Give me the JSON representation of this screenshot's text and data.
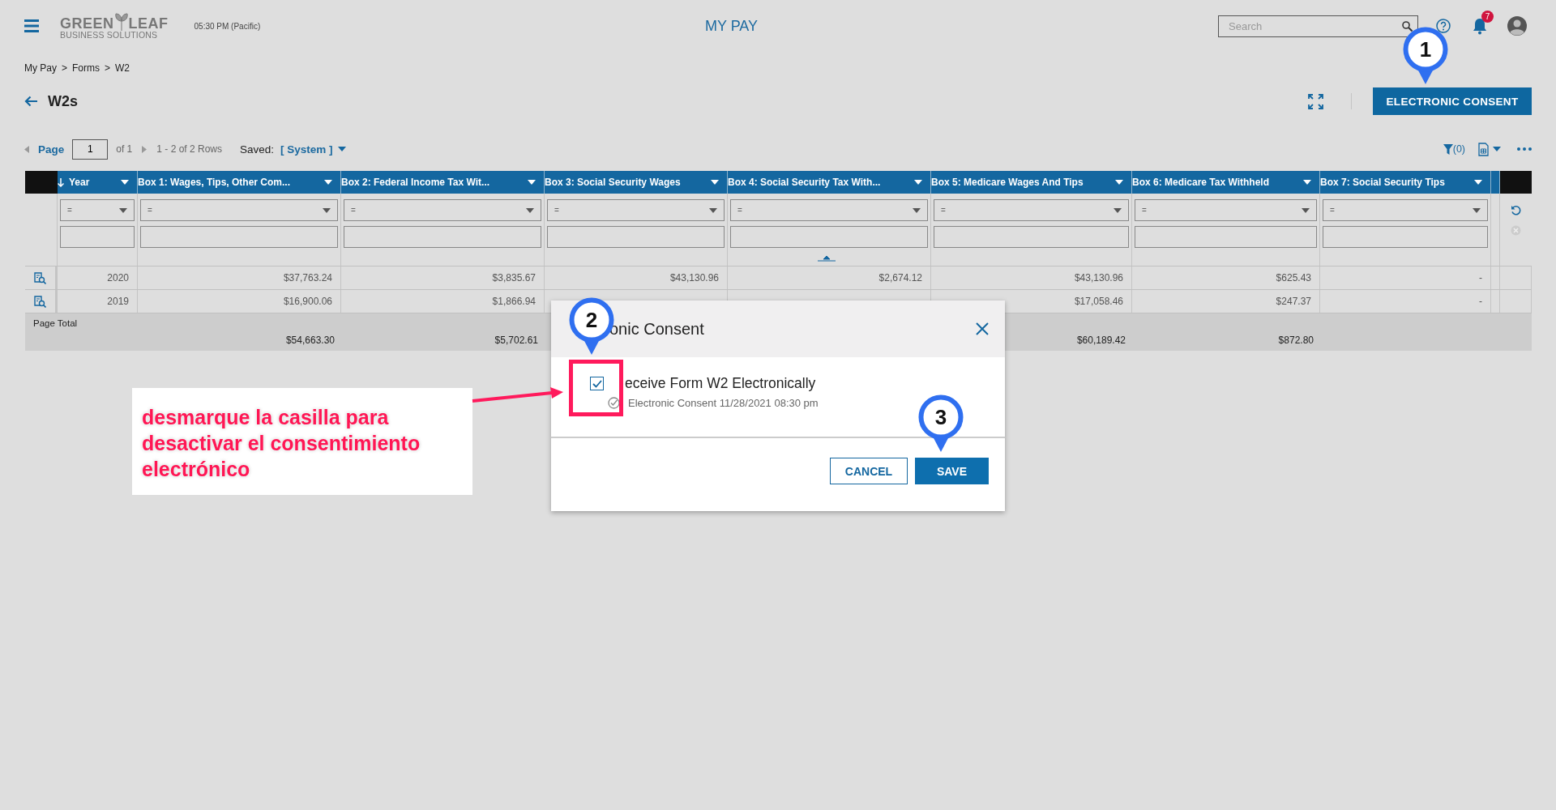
{
  "header": {
    "logo": {
      "left": "GREEN",
      "right": "LEAF",
      "tagline": "BUSINESS SOLUTIONS"
    },
    "time": "05:30 PM (Pacific)",
    "title": "MY PAY",
    "search": {
      "placeholder": "Search"
    },
    "notifications": "7"
  },
  "breadcrumb": {
    "items": [
      "My Pay",
      "Forms",
      "W2"
    ],
    "separator": ">"
  },
  "page_title": "W2s",
  "consent_button": "ELECTRONIC CONSENT",
  "pager": {
    "label": "Page",
    "value": "1",
    "of": "of 1",
    "rows": "1 - 2 of 2 Rows",
    "saved_label": "Saved:",
    "saved_value": "[ System ]"
  },
  "filter_count": "(0)",
  "table": {
    "columns": [
      {
        "label": "Year",
        "sorted": true
      },
      {
        "label": "Box 1: Wages, Tips, Other Com...",
        "sorted": false
      },
      {
        "label": "Box 2: Federal Income Tax Wit...",
        "sorted": false
      },
      {
        "label": "Box 3: Social Security Wages",
        "sorted": false
      },
      {
        "label": "Box 4: Social Security Tax With...",
        "sorted": false
      },
      {
        "label": "Box 5: Medicare Wages And Tips",
        "sorted": false
      },
      {
        "label": "Box 6: Medicare Tax Withheld",
        "sorted": false
      },
      {
        "label": "Box 7: Social Security Tips",
        "sorted": false
      }
    ],
    "filter_operator": "=",
    "rows": [
      {
        "year": "2020",
        "box_1": "$37,763.24",
        "box_2": "$3,835.67",
        "box_3": "$43,130.96",
        "box_4": "$2,674.12",
        "box_5": "$43,130.96",
        "box_6": "$625.43",
        "box_7": "-"
      },
      {
        "year": "2019",
        "box_1": "$16,900.06",
        "box_2": "$1,866.94",
        "box_5": "$17,058.46",
        "box_6": "$247.37",
        "box_7": "-"
      }
    ],
    "total": {
      "label": "Page Total",
      "box_1": "$54,663.30",
      "box_2": "$5,702.61",
      "box_5": "$60,189.42",
      "box_6": "$872.80"
    }
  },
  "dialog": {
    "title": "onic Consent",
    "checkbox": {
      "label": "eceive Form W2 Electronically",
      "checked": true
    },
    "note": "Electronic Consent 11/28/2021 08:30 pm",
    "buttons": [
      {
        "label": "CANCEL",
        "kind": "secondary"
      },
      {
        "label": "SAVE",
        "kind": "primary"
      }
    ]
  },
  "annotation": {
    "lines": [
      "desmarque la casilla para",
      "desactivar el consentimiento",
      "electrónico"
    ]
  },
  "markers": [
    "1",
    "2",
    "3"
  ]
}
